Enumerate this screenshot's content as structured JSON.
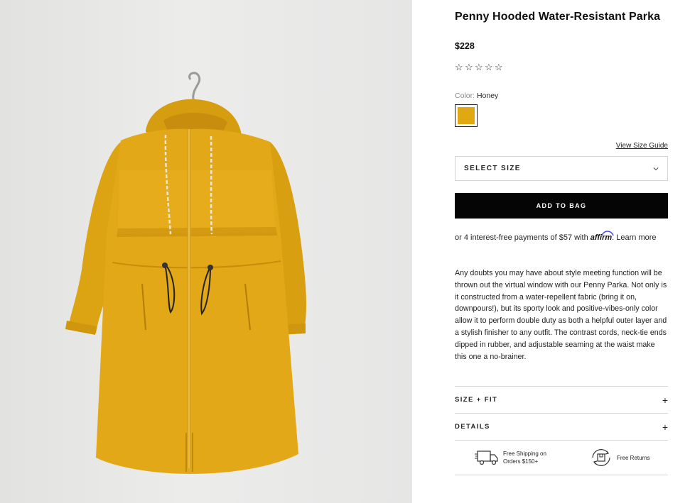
{
  "product": {
    "title": "Penny Hooded Water-Resistant Parka",
    "price": "$228",
    "rating_stars": [
      "☆",
      "☆",
      "☆",
      "☆",
      "☆"
    ]
  },
  "color": {
    "label": "Color:",
    "value": "Honey",
    "swatch_hex": "#e0a812"
  },
  "size": {
    "guide_link": "View Size Guide",
    "select_label": "SELECT SIZE"
  },
  "actions": {
    "add_to_bag": "ADD TO BAG"
  },
  "affirm": {
    "text_before": "or 4 interest-free payments of $57 with",
    "logo": "affirm",
    "text_after": ". ",
    "learn_more": "Learn more"
  },
  "description": "Any doubts you may have about style meeting function will be thrown out the virtual window with our Penny Parka. Not only is it constructed from a water-repellent fabric (bring it on, downpours!), but its sporty look and positive-vibes-only color allow it to perform double duty as both a helpful outer layer and a stylish finisher to any outfit. The contrast cords, neck-tie ends dipped in rubber, and adjustable seaming at the waist make this one a no-brainer.",
  "accordions": [
    {
      "label": "SIZE + FIT",
      "icon": "+"
    },
    {
      "label": "DETAILS",
      "icon": "+"
    }
  ],
  "perks": {
    "shipping_line1": "Free Shipping on",
    "shipping_line2": "Orders $150+",
    "returns": "Free Returns"
  },
  "colors": {
    "parka_main": "#e2a818",
    "parka_shadow": "#c88d0c",
    "button_bg": "#050505",
    "affirm_arc": "#4a4af4"
  }
}
